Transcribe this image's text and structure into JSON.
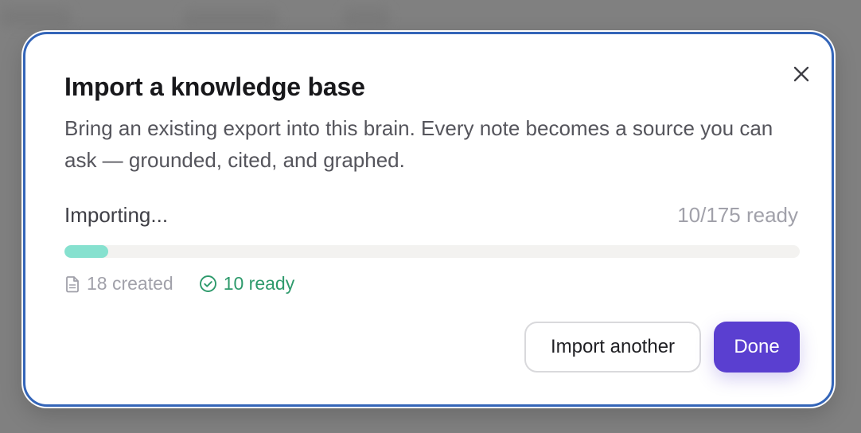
{
  "dialog": {
    "title": "Import a knowledge base",
    "description": "Bring an existing export into this brain. Every note becomes a source you can ask — grounded, cited, and graphed.",
    "close_icon": "close-icon"
  },
  "progress": {
    "label": "Importing...",
    "count_text": "10/175 ready",
    "ready": 10,
    "total": 175,
    "fill_color": "#86e1cf"
  },
  "stats": {
    "created_icon": "document-icon",
    "created_text": "18 created",
    "ready_icon": "check-circle-icon",
    "ready_text": "10 ready",
    "ready_color": "#2e9a6c"
  },
  "actions": {
    "import_another_label": "Import another",
    "done_label": "Done",
    "primary_color": "#5a3fd0",
    "focus_border_color": "#3465b8"
  }
}
